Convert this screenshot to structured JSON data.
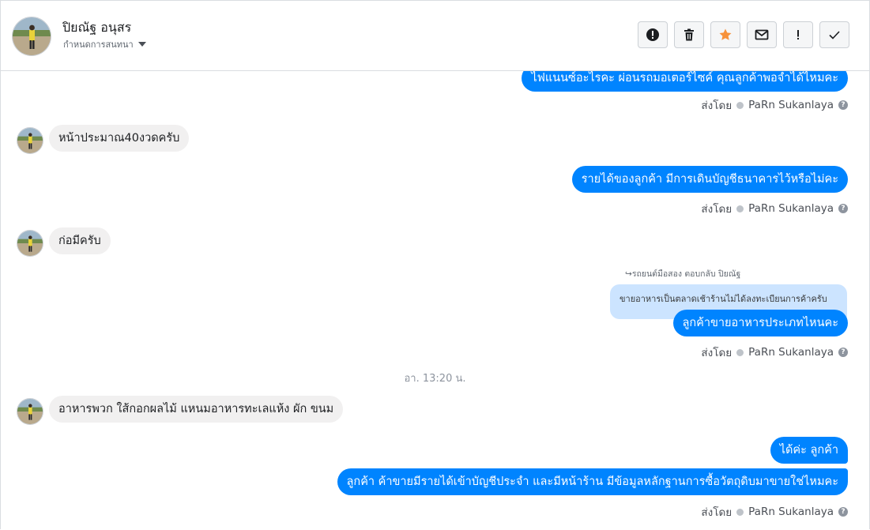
{
  "contact": {
    "name": "ปิยณัฐ อนุสร",
    "subtitle": "กำหนดการสนทนา"
  },
  "toolbar": {
    "buttons": [
      {
        "name": "report-button",
        "icon": "exclamation-circle-icon"
      },
      {
        "name": "delete-button",
        "icon": "trash-icon"
      },
      {
        "name": "star-button",
        "icon": "star-icon",
        "color": "#f7923b"
      },
      {
        "name": "mark-unread-button",
        "icon": "envelope-icon"
      },
      {
        "name": "important-button",
        "icon": "exclamation-icon",
        "label": "!"
      },
      {
        "name": "done-button",
        "icon": "check-icon"
      }
    ]
  },
  "messages": {
    "m1": "ไฟแนนซ์อะไรคะ ผ่อนรถมอเตอร์ไซค์ คุณลูกค้าพอจำได้ไหมคะ",
    "m2": "หน้าประมาณ40งวดครับ",
    "m3": "รายได้ของลูกค้า มีการเดินบัญชีธนาคารไว้หรือไม่คะ",
    "m4": "ก่อมีครับ",
    "reply_label": "รถยนต์มือสอง ตอบกลับ ปิยณัฐ",
    "quoted": "ขายอาหารเป็นตลาดเช้าร้านไม่ได้ลงทะเบียนการค้าครับ",
    "m5": "ลูกค้าขายอาหารประเภทไหนคะ",
    "timestamp": "อา. 13:20 น.",
    "m6": "อาหารพวก ใส้กอกผลไม้ แหนมอาหารทะเลแห้ง ผัก ขนม",
    "m7": "ได้ค่ะ ลูกค้า",
    "m8": "ลูกค้า ค้าขายมีรายได้เข้าบัญชีประจำ และมีหน้าร้าน   มีข้อมูลหลักฐานการซื้อวัตถุดิบมาขายใช่ไหมคะ"
  },
  "sent_by": {
    "prefix": "ส่งโดย",
    "agent": "PaRn Sukanlaya",
    "help": "?"
  },
  "colors": {
    "outgoing_bubble": "#0084ff",
    "incoming_bubble": "#f1f0f0",
    "quoted_bubble": "#cce4ff"
  }
}
